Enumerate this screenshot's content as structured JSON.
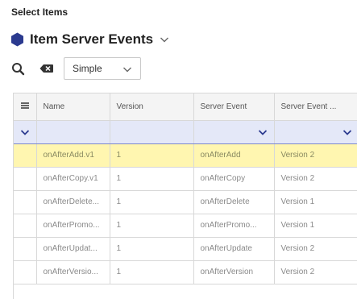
{
  "header": {
    "label": "Select Items"
  },
  "title": {
    "text": "Item Server Events",
    "icon": "hexagon-icon",
    "color": "#2b3a8f"
  },
  "toolbar": {
    "search_icon": "search-icon",
    "clear_icon": "clear-filter-icon",
    "mode_selected": "Simple"
  },
  "grid": {
    "columns": [
      "Name",
      "Version",
      "Server Event",
      "Server Event ..."
    ],
    "rows": [
      {
        "name": "onAfterAdd.v1",
        "version": "1",
        "server_event": "onAfterAdd",
        "server_event_version": "Version 2",
        "selected": true
      },
      {
        "name": "onAfterCopy.v1",
        "version": "1",
        "server_event": "onAfterCopy",
        "server_event_version": "Version 2",
        "selected": false
      },
      {
        "name": "onAfterDelete...",
        "version": "1",
        "server_event": "onAfterDelete",
        "server_event_version": "Version 1",
        "selected": false
      },
      {
        "name": "onAfterPromo...",
        "version": "1",
        "server_event": "onAfterPromo...",
        "server_event_version": "Version 1",
        "selected": false
      },
      {
        "name": "onAfterUpdat...",
        "version": "1",
        "server_event": "onAfterUpdate",
        "server_event_version": "Version 2",
        "selected": false
      },
      {
        "name": "onAfterVersio...",
        "version": "1",
        "server_event": "onAfterVersion",
        "server_event_version": "Version 2",
        "selected": false
      }
    ]
  },
  "colors": {
    "accent": "#2b3a8f",
    "selected_row": "#fff6b0",
    "filter_row": "#e4e8f8"
  }
}
